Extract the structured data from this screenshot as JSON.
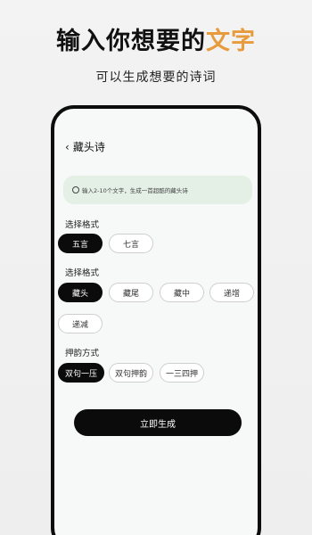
{
  "hero": {
    "title_main": "输入你想要的",
    "title_accent": "文字",
    "subtitle": "可以生成想要的诗词"
  },
  "app": {
    "screen_title": "藏头诗",
    "search": {
      "placeholder": "输入2-10个文字，生成一首超酷的藏头诗"
    },
    "format_section_1": {
      "label": "选择格式",
      "options": [
        "五言",
        "七言"
      ],
      "selected": "五言"
    },
    "format_section_2": {
      "label": "选择格式",
      "options": [
        "藏头",
        "藏尾",
        "藏中",
        "递增",
        "递减"
      ],
      "selected": "藏头"
    },
    "rhyme_section": {
      "label": "押韵方式",
      "options": [
        "双句一压",
        "双句押韵",
        "一三四押"
      ],
      "selected": "双句一压"
    },
    "generate_label": "立即生成"
  },
  "colors": {
    "accent": "#e89b3c",
    "selected_chip": "#0b0b0b",
    "search_bg": "#e4efe6"
  }
}
